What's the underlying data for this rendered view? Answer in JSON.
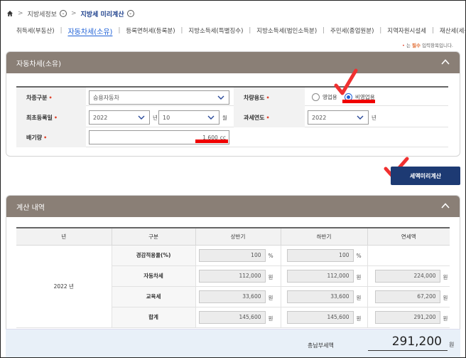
{
  "breadcrumb": {
    "level1": "지방세정보",
    "level2": "지방세 미리계산"
  },
  "tabs": [
    {
      "label": "취득세(부동산)"
    },
    {
      "label": "자동차세(소유)"
    },
    {
      "label": "등록면허세(등록분)"
    },
    {
      "label": "지방소득세(특별징수)"
    },
    {
      "label": "지방소득세(법인소득분)"
    },
    {
      "label": "주민세(종업원분)"
    },
    {
      "label": "지역자원시설세"
    },
    {
      "label": "재산세(세율특례)"
    }
  ],
  "required_note": {
    "prefix": "는",
    "em": "필수",
    "suffix": "입력항목입니다."
  },
  "form_panel": {
    "title": "자동차세(소유)",
    "vehicle_type": {
      "label": "차종구분",
      "value": "승용자동차"
    },
    "vehicle_use": {
      "label": "차량용도",
      "options": [
        "영업용",
        "비영업용"
      ],
      "selected": "비영업용"
    },
    "first_reg": {
      "label": "최초등록일",
      "year": "2022",
      "year_unit": "년",
      "month": "10",
      "month_unit": "월"
    },
    "tax_year": {
      "label": "과세연도",
      "value": "2022",
      "unit": "년"
    },
    "displacement": {
      "label": "배기량",
      "value": "1,600",
      "unit": "cc"
    }
  },
  "calc_button": "세액미리계산",
  "result_panel": {
    "title": "계산 내역",
    "headers": [
      "년",
      "구분",
      "상반기",
      "하반기",
      "연세액"
    ],
    "year": "2022 년",
    "rows": [
      {
        "label": "경감적용율(%)",
        "h1": "100",
        "h1_unit": "%",
        "h2": "100",
        "h2_unit": "%",
        "annual": "",
        "annual_unit": ""
      },
      {
        "label": "자동차세",
        "h1": "112,000",
        "h1_unit": "원",
        "h2": "112,000",
        "h2_unit": "원",
        "annual": "224,000",
        "annual_unit": "원"
      },
      {
        "label": "교육세",
        "h1": "33,600",
        "h1_unit": "원",
        "h2": "33,600",
        "h2_unit": "원",
        "annual": "67,200",
        "annual_unit": "원"
      },
      {
        "label": "합계",
        "h1": "145,600",
        "h1_unit": "원",
        "h2": "145,600",
        "h2_unit": "원",
        "annual": "291,200",
        "annual_unit": "원"
      }
    ],
    "total_label": "총납부세액",
    "total_value": "291,200",
    "total_unit": "원"
  },
  "icons": {
    "home": "home-icon",
    "chevron_circle": "chevron-down-circle-icon",
    "collapse": "chevron-up-icon",
    "dropdown": "chevron-down-icon"
  },
  "colors": {
    "accent": "#1c5fd6",
    "header_bg": "#8a7f76",
    "button_bg": "#1d3a73",
    "required": "#e0462f",
    "annotation": "#f00000"
  }
}
